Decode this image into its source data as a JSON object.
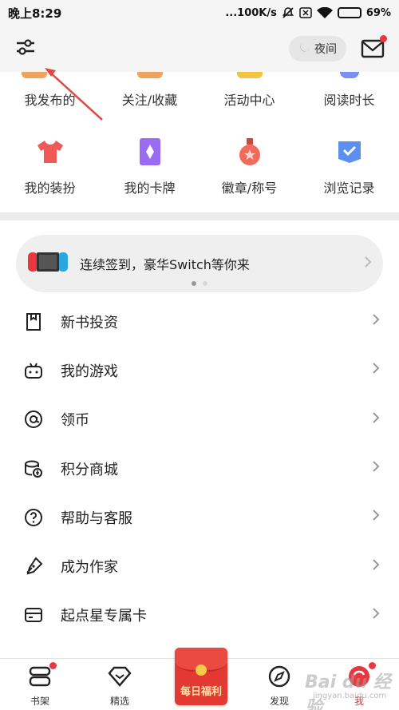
{
  "status_bar": {
    "time": "晚上8:29",
    "network_speed": "...100K/s",
    "battery": "69%",
    "battery_level": 0.69
  },
  "header": {
    "night_label": "夜间"
  },
  "grid": {
    "row1": [
      {
        "label": "我发布的",
        "color": "#f0a35e"
      },
      {
        "label": "关注/收藏",
        "color": "#f0a35e"
      },
      {
        "label": "活动中心",
        "color": "#f3c442"
      },
      {
        "label": "阅读时长",
        "color": "#7a8ff0"
      }
    ],
    "row2": [
      {
        "label": "我的装扮",
        "icon": "tshirt-icon",
        "color": "#ef5a56"
      },
      {
        "label": "我的卡牌",
        "icon": "card-icon",
        "color": "#9b6cf2"
      },
      {
        "label": "徽章/称号",
        "icon": "medal-icon",
        "color": "#f26b5a"
      },
      {
        "label": "浏览记录",
        "icon": "history-icon",
        "color": "#5b8ff0"
      }
    ]
  },
  "banner": {
    "text": "连续签到，豪华Switch等你来"
  },
  "list": [
    {
      "label": "新书投资",
      "icon": "bookmark-icon"
    },
    {
      "label": "我的游戏",
      "icon": "gamepad-icon"
    },
    {
      "label": "领币",
      "icon": "coin-at-icon"
    },
    {
      "label": "积分商城",
      "icon": "points-shop-icon"
    },
    {
      "label": "帮助与客服",
      "icon": "help-icon"
    },
    {
      "label": "成为作家",
      "icon": "pen-icon"
    },
    {
      "label": "起点星专属卡",
      "icon": "card-outline-icon"
    }
  ],
  "tabbar": {
    "tabs": [
      {
        "label": "书架",
        "icon": "bookshelf-icon"
      },
      {
        "label": "精选",
        "icon": "diamond-icon"
      },
      {
        "label": "每日福利",
        "icon": "red-envelope-icon"
      },
      {
        "label": "发现",
        "icon": "compass-icon"
      },
      {
        "label": "我",
        "icon": "me-icon"
      }
    ]
  },
  "watermark": {
    "text": "Bai du 经验",
    "sub": "jingyan.baidu.com"
  },
  "colors": {
    "accent_red": "#e8383d",
    "banner_bg": "#efefef"
  }
}
